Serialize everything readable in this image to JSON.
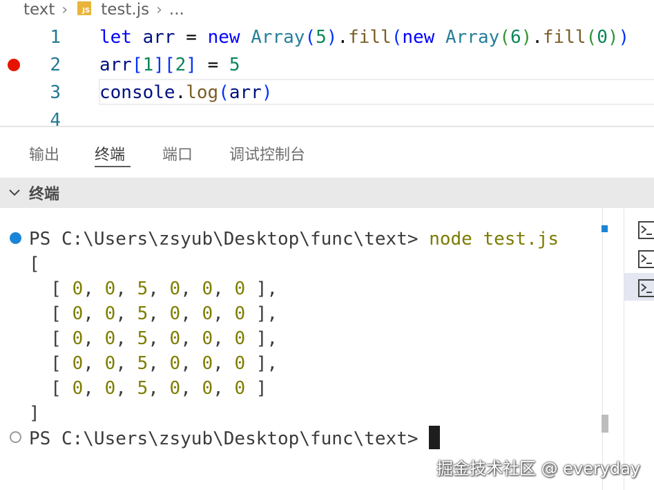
{
  "breadcrumb": {
    "folder": "text",
    "file_badge": "JS",
    "file": "test.js",
    "more": "..."
  },
  "editor": {
    "lines": [
      {
        "number": "1"
      },
      {
        "number": "2",
        "breakpoint": true
      },
      {
        "number": "3"
      },
      {
        "number": "4"
      }
    ],
    "code_lines": [
      "let arr = new Array(5).fill(new Array(6).fill(0))",
      "arr[1][2] = 5",
      "console.log(arr)",
      ""
    ],
    "current_line": 3
  },
  "panel": {
    "tabs": [
      {
        "label": "输出"
      },
      {
        "label": "终端",
        "active": true
      },
      {
        "label": "端口"
      },
      {
        "label": "调试控制台"
      }
    ],
    "terminal_title": "终端"
  },
  "terminal": {
    "prompt": "PS C:\\Users\\zsyub\\Desktop\\func\\text> ",
    "command": "node test.js",
    "output": {
      "open": "[",
      "rows": [
        [
          "0",
          "0",
          "5",
          "0",
          "0",
          "0"
        ],
        [
          "0",
          "0",
          "5",
          "0",
          "0",
          "0"
        ],
        [
          "0",
          "0",
          "5",
          "0",
          "0",
          "0"
        ],
        [
          "0",
          "0",
          "5",
          "0",
          "0",
          "0"
        ],
        [
          "0",
          "0",
          "5",
          "0",
          "0",
          "0"
        ]
      ],
      "close": "]"
    },
    "prompt2": "PS C:\\Users\\zsyub\\Desktop\\func\\text> "
  },
  "side_terminals": [
    "terminal-icon",
    "terminal-icon",
    "terminal-icon"
  ],
  "watermark": "掘金技术社区 @ everyday",
  "colors": {
    "keyword": "#0000ff",
    "type": "#267f99",
    "function": "#795e26",
    "number": "#098658",
    "breakpoint": "#e51400",
    "line_number": "#237893",
    "terminal_status_blue": "#1a85d6"
  }
}
